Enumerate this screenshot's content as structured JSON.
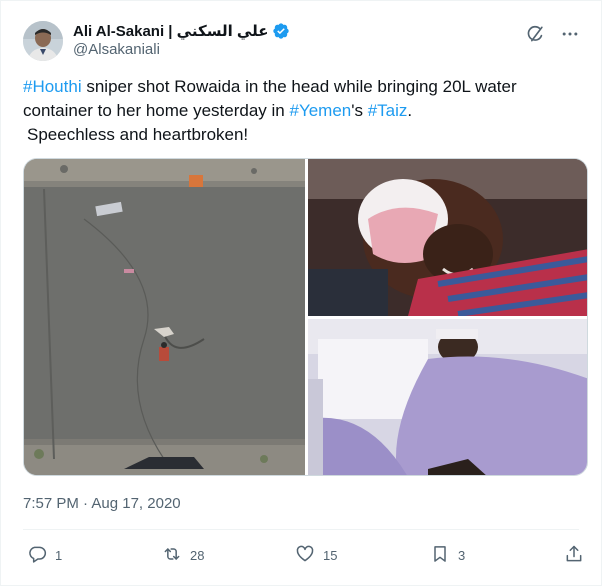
{
  "author": {
    "display_name": "Ali Al-Sakani | علي السكني",
    "handle": "@Alsakaniali",
    "verified": true
  },
  "tweet": {
    "line1": {
      "tag1": "#Houthi",
      "text1": " sniper shot Rowaida in the head while bringing 20L water container to her home yesterday in ",
      "tag2": "#Yemen",
      "text2": "'s ",
      "tag3": "#Taiz",
      "text3": "."
    },
    "line2": "Speechless and heartbroken!"
  },
  "timestamp": {
    "time": "7:57 PM",
    "separator": " · ",
    "date": "Aug 17, 2020"
  },
  "actions": {
    "replies": "1",
    "reposts": "28",
    "likes": "15",
    "bookmarks": "3"
  },
  "icons": {
    "verified": "verified-badge-icon",
    "grok": "grok-icon",
    "more": "more-icon",
    "reply": "reply-icon",
    "repost": "repost-icon",
    "like": "like-icon",
    "bookmark": "bookmark-icon",
    "share": "share-icon"
  },
  "colors": {
    "accent": "#1d9bf0",
    "text": "#0f1419",
    "muted": "#536471"
  }
}
